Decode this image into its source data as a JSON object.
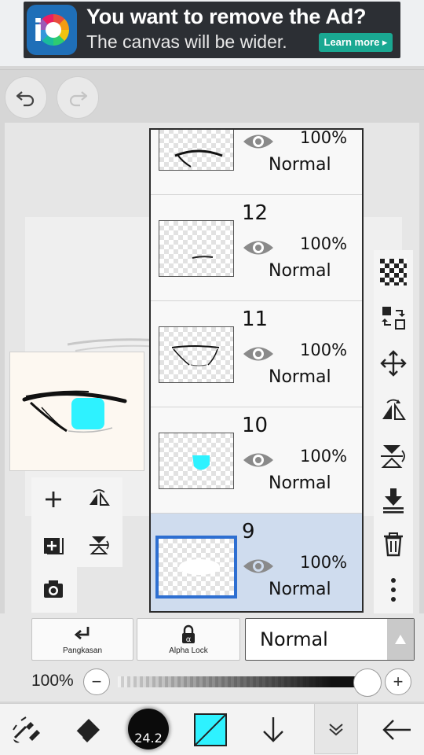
{
  "ad": {
    "title": "You want to remove the Ad?",
    "subtitle": "The canvas will be wider.",
    "button": "Learn more ▸",
    "logo_icon": "ibis-paint-logo-icon"
  },
  "toolbar": {
    "undo_icon": "undo-icon",
    "redo_icon": "redo-icon"
  },
  "layers": [
    {
      "number": "",
      "opacity": "100%",
      "blend": "Normal",
      "visible": true,
      "selected": false
    },
    {
      "number": "12",
      "opacity": "100%",
      "blend": "Normal",
      "visible": true,
      "selected": false
    },
    {
      "number": "11",
      "opacity": "100%",
      "blend": "Normal",
      "visible": true,
      "selected": false
    },
    {
      "number": "10",
      "opacity": "100%",
      "blend": "Normal",
      "visible": true,
      "selected": false
    },
    {
      "number": "9",
      "opacity": "100%",
      "blend": "Normal",
      "visible": true,
      "selected": true
    }
  ],
  "layer_controls": {
    "clipping_label": "Pangkasan",
    "alpha_lock_label": "Alpha Lock",
    "blend_mode": "Normal"
  },
  "opacity": {
    "label": "100%",
    "minus": "−",
    "plus": "+",
    "value": 1.0
  },
  "brush": {
    "size": "24.2",
    "color": "#2ef2ff"
  },
  "colors": {
    "selection": "#2e6fd1",
    "ad_button": "#1aa892",
    "cyan": "#2ef2ff"
  }
}
